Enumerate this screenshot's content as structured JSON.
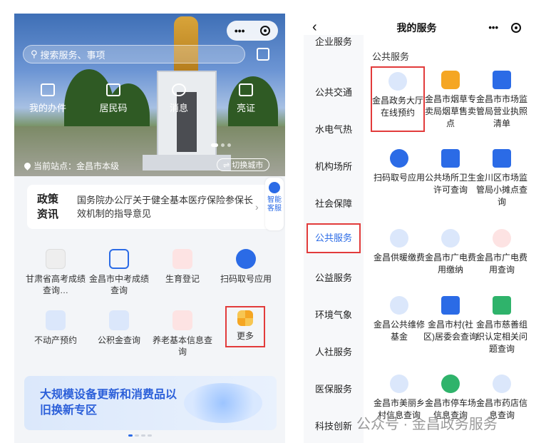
{
  "left": {
    "search_placeholder": "搜索服务、事项",
    "quick_actions": [
      "我的办件",
      "居民码",
      "消息",
      "亮证"
    ],
    "station_label": "当前站点：金昌市本级",
    "switch_city": "切换城市",
    "news_tag": "政策资讯",
    "news_text": "国务院办公厅关于健全基本医疗保险参保长效机制的指导意见",
    "helper_label": "智能客服",
    "services": [
      "甘肃省高考成绩查询…",
      "金昌市中考成绩查询",
      "生育登记",
      "扫码取号应用",
      "不动产预约",
      "公积金查询",
      "养老基本信息查询",
      "更多"
    ],
    "banner_text": "大规模设备更新和消费品以旧换新专区"
  },
  "right": {
    "title": "我的服务",
    "sidebar": [
      "企业服务",
      "公共交通",
      "水电气热",
      "机构场所",
      "社会保障",
      "公共服务",
      "公益服务",
      "环境气象",
      "人社服务",
      "医保服务",
      "科技创新"
    ],
    "section_title": "公共服务",
    "services": [
      "金昌政务大厅在线预约",
      "金昌市烟草专卖局烟草售卖点",
      "金昌市市场监管局营业执照清单",
      "扫码取号应用",
      "公共场所卫生许可查询",
      "金川区市场监管局小摊点查询",
      "金昌供暖缴费",
      "金昌市广电费用缴纳",
      "金昌市广电费用查询",
      "金昌公共维修基金",
      "金昌市村(社区)居委会查询",
      "金昌市慈善组织认定相关问题查询",
      "金昌市美丽乡村信息查询",
      "金昌市停车场信息查询",
      "金昌市药店信息查询"
    ]
  },
  "watermark": "公众号 · 金昌政务服务",
  "colors": {
    "accent": "#2b6be6",
    "highlight": "#e23b3b"
  }
}
